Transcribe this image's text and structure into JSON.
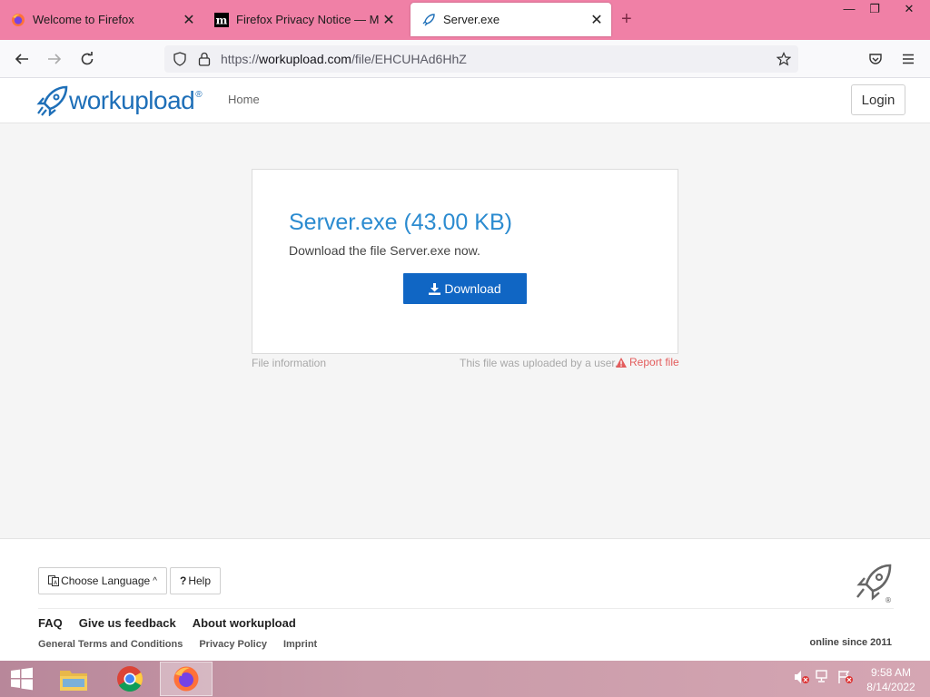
{
  "browser": {
    "tabs": [
      {
        "title": "Welcome to Firefox",
        "icon": "firefox-icon",
        "active": false
      },
      {
        "title": "Firefox Privacy Notice — Mozilla",
        "icon": "mozilla-m-icon",
        "active": false
      },
      {
        "title": "Server.exe",
        "icon": "workupload-rocket-icon",
        "active": true
      }
    ],
    "url_prefix": "https://",
    "url_host": "workupload.com",
    "url_path": "/file/EHCUHAd6HhZ"
  },
  "site": {
    "logo_text_work": "work",
    "logo_text_upload": "upload",
    "logo_registered": "®",
    "nav_home": "Home",
    "login_label": "Login"
  },
  "file": {
    "heading": "Server.exe (43.00 KB)",
    "description": "Download the file Server.exe now.",
    "download_label": "Download",
    "file_information": "File information",
    "uploaded_note": "This file was uploaded by a user.",
    "report_label": "Report file"
  },
  "footer": {
    "language_label": "Choose Language",
    "help_label": "Help",
    "links": [
      "FAQ",
      "Give us feedback",
      "About workupload"
    ],
    "sublinks": [
      "General Terms and Conditions",
      "Privacy Policy",
      "Imprint"
    ],
    "online_since": "online since 2011",
    "registered": "®"
  },
  "taskbar": {
    "time": "9:58 AM",
    "date": "8/14/2022"
  },
  "colors": {
    "titlebar": "#f080a6",
    "brand_blue": "#1e6fb8",
    "download_button": "#1066c4",
    "report_red": "#e35d5d"
  }
}
